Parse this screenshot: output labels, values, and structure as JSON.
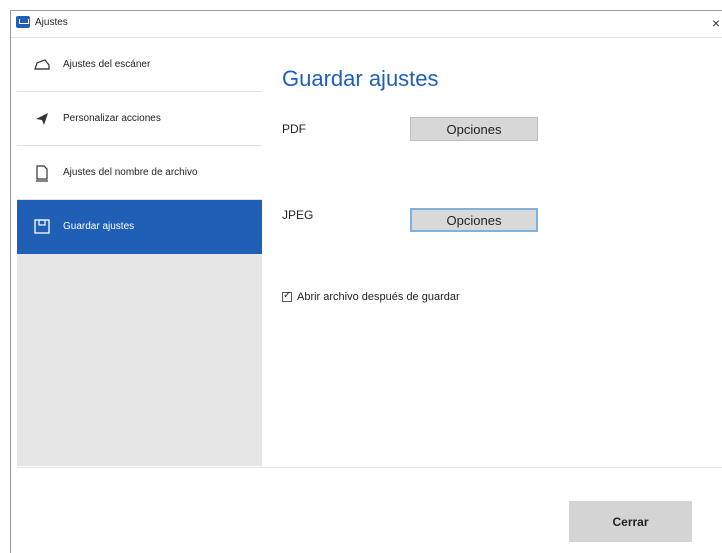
{
  "window": {
    "title": "Ajustes",
    "close_glyph": "×"
  },
  "sidebar": {
    "items": [
      {
        "label": "Ajustes del escáner",
        "icon": "scanner-icon",
        "active": false
      },
      {
        "label": "Personalizar acciones",
        "icon": "send-icon",
        "active": false
      },
      {
        "label": "Ajustes del nombre de archivo",
        "icon": "document-icon",
        "active": false
      },
      {
        "label": "Guardar ajustes",
        "icon": "save-icon",
        "active": true
      }
    ]
  },
  "main": {
    "heading": "Guardar ajustes",
    "rows": [
      {
        "label": "PDF",
        "button_label": "Opciones"
      },
      {
        "label": "JPEG",
        "button_label": "Opciones"
      }
    ],
    "open_after_save": {
      "label": "Abrir archivo después de guardar",
      "checked": true
    }
  },
  "footer": {
    "close_label": "Cerrar"
  },
  "colors": {
    "accent": "#1f5fb5",
    "sidebar_bg": "#e6e6e6",
    "button_bg": "#d7d7d7"
  }
}
